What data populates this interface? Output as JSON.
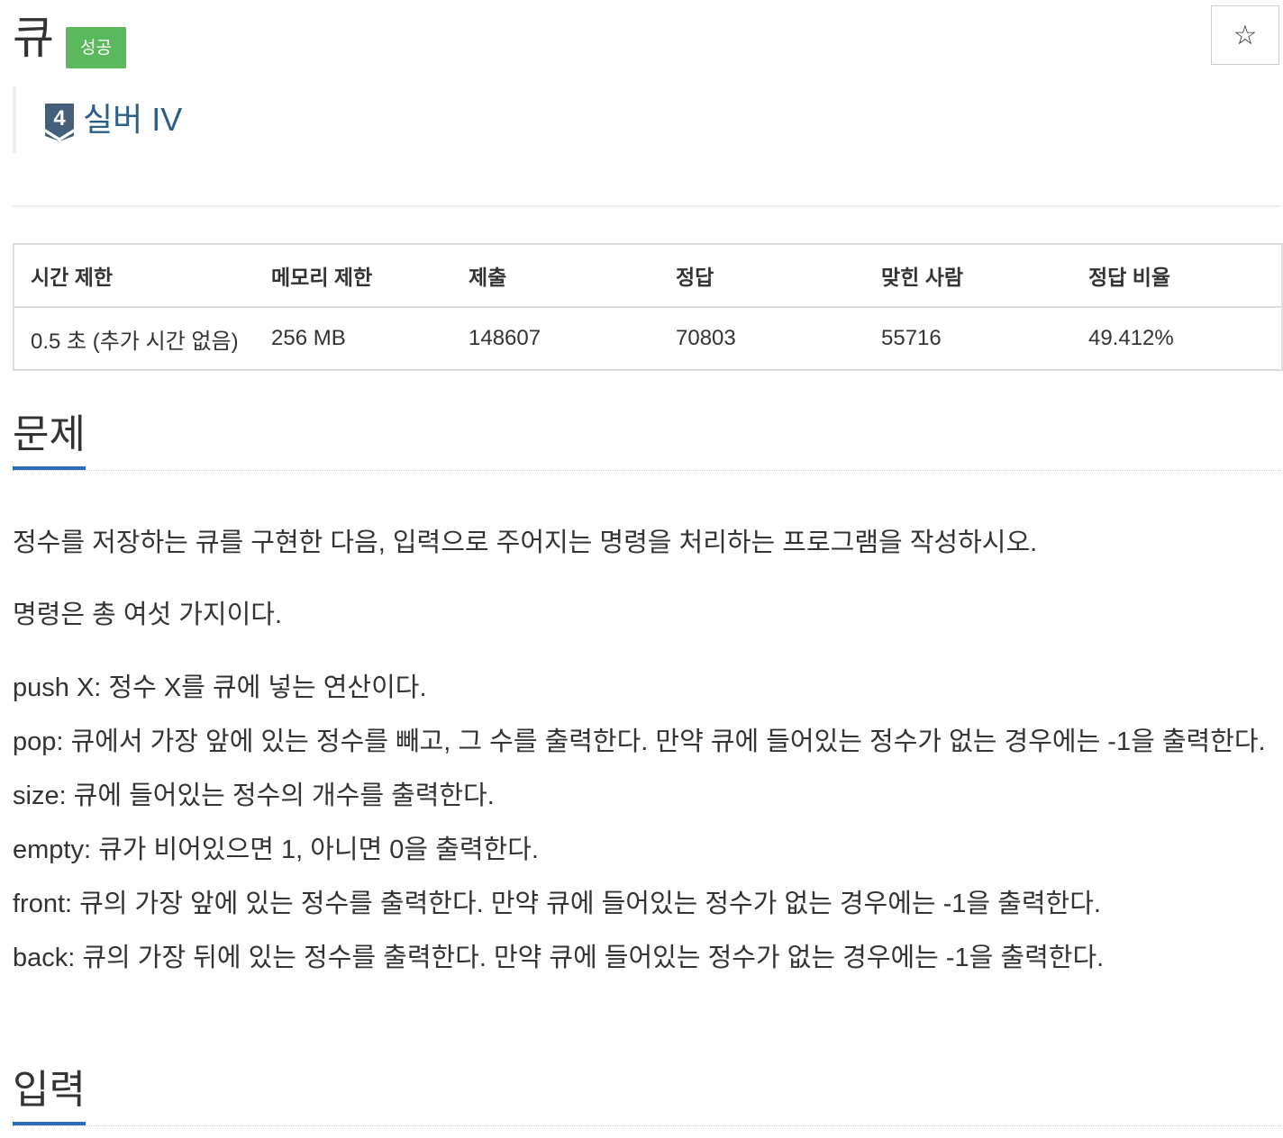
{
  "problem": {
    "title": "큐",
    "status": "성공",
    "tier_number": "4",
    "tier": "실버 IV",
    "star_icon": "☆"
  },
  "colors": {
    "status_green": "#5cb85c",
    "tier_blue": "#2c5e8a",
    "heading_underline": "#2a6ebb"
  },
  "info_table": {
    "headers": [
      "시간 제한",
      "메모리 제한",
      "제출",
      "정답",
      "맞힌 사람",
      "정답 비율"
    ],
    "row": [
      "0.5 초 (추가 시간 없음)",
      "256 MB",
      "148607",
      "70803",
      "55716",
      "49.412%"
    ]
  },
  "sections": {
    "problem_heading": "문제",
    "input_heading": "입력"
  },
  "description": {
    "p1": "정수를 저장하는 큐를 구현한 다음, 입력으로 주어지는 명령을 처리하는 프로그램을 작성하시오.",
    "p2": "명령은 총 여섯 가지이다.",
    "commands": [
      "push X: 정수 X를 큐에 넣는 연산이다.",
      "pop: 큐에서 가장 앞에 있는 정수를 빼고, 그 수를 출력한다. 만약 큐에 들어있는 정수가 없는 경우에는 -1을 출력한다.",
      "size: 큐에 들어있는 정수의 개수를 출력한다.",
      "empty: 큐가 비어있으면 1, 아니면 0을 출력한다.",
      "front: 큐의 가장 앞에 있는 정수를 출력한다. 만약 큐에 들어있는 정수가 없는 경우에는 -1을 출력한다.",
      "back: 큐의 가장 뒤에 있는 정수를 출력한다. 만약 큐에 들어있는 정수가 없는 경우에는 -1을 출력한다."
    ]
  }
}
